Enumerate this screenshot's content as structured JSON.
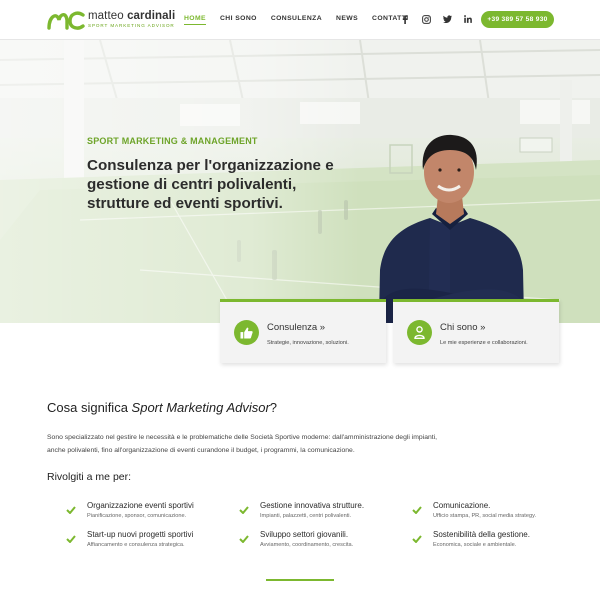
{
  "header": {
    "logo_first": "matteo",
    "logo_last": "cardinali",
    "logo_tagline": "SPORT MARKETING ADVISOR",
    "nav": [
      {
        "label": "HOME",
        "active": true
      },
      {
        "label": "CHI SONO",
        "active": false
      },
      {
        "label": "CONSULENZA",
        "active": false
      },
      {
        "label": "NEWS",
        "active": false
      },
      {
        "label": "CONTATTI",
        "active": false
      }
    ],
    "social": [
      "facebook-icon",
      "instagram-icon",
      "twitter-icon",
      "linkedin-icon"
    ],
    "phone": "+39 389 57 58 930"
  },
  "hero": {
    "kicker": "SPORT MARKETING & MANAGEMENT",
    "headline": "Consulenza per l'organizzazione e gestione di centri polivalenti, strutture ed eventi sportivi."
  },
  "cards": [
    {
      "title": "Consulenza »",
      "subtitle": "Strategie, innovazione, soluzioni.",
      "icon": "thumbs-up-icon"
    },
    {
      "title": "Chi sono »",
      "subtitle": "Le mie esperienze e collaborazioni.",
      "icon": "user-icon"
    }
  ],
  "about": {
    "title_plain": "Cosa significa ",
    "title_italic": "Sport Marketing Advisor",
    "title_end": "?",
    "paragraph": "Sono specializzato nel gestire le necessità e le problematiche delle Società Sportive moderne: dall'amministrazione degli impianti, anche polivalenti, fino all'organizzazione di eventi curandone il budget, i programmi, la comunicazione.",
    "rely_title": "Rivolgiti a me per:"
  },
  "features": [
    {
      "title": "Organizzazione eventi sportivi",
      "subtitle": "Pianificazione, sponsor, comunicazione."
    },
    {
      "title": "Gestione innovativa strutture.",
      "subtitle": "Impianti, palazzetti, centri polivalenti."
    },
    {
      "title": "Comunicazione.",
      "subtitle": "Ufficio stampa, PR, social media strategy."
    },
    {
      "title": "Start-up nuovi progetti sportivi",
      "subtitle": "Affiancamento e consulenza strategica."
    },
    {
      "title": "Sviluppo settori giovanili.",
      "subtitle": "Avviamento, coordinamento, crescita."
    },
    {
      "title": "Sostenibilità della gestione.",
      "subtitle": "Economica, sociale e ambientale."
    }
  ],
  "colors": {
    "accent": "#7cb82f",
    "text": "#2b2b2b"
  }
}
